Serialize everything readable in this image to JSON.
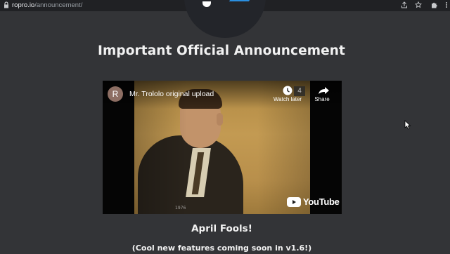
{
  "browser": {
    "url_domain": "ropro.io",
    "url_path": "/announcement/",
    "icons": [
      "site-info-icon",
      "share-icon",
      "bookmark-star-icon",
      "extensions-puzzle-icon",
      "menu-icon"
    ]
  },
  "page": {
    "title": "Important Official Announcement",
    "april": "April Fools!",
    "subtitle": "(Cool new features coming soon in v1.6!)"
  },
  "video": {
    "channel_initial": "R",
    "title": "Mr. Trololo original upload",
    "watch_later_label": "Watch later",
    "share_label": "Share",
    "youtube_label": "YouTube",
    "badge": "4",
    "year": "1976"
  },
  "colors": {
    "background": "#333437",
    "browser_bar": "#202124",
    "logo_blue": "#2a8fe0",
    "text": "#f2f2f2",
    "youtube_red": "#ff0000"
  }
}
